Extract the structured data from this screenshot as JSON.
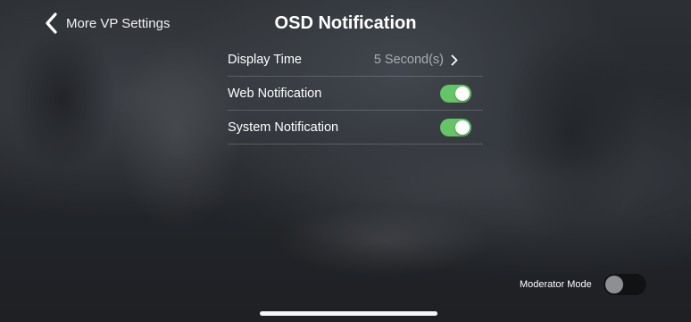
{
  "header": {
    "back_label": "More VP Settings",
    "title": "OSD Notification"
  },
  "settings": {
    "display_time": {
      "label": "Display Time",
      "value": "5 Second(s)"
    },
    "web_notification": {
      "label": "Web Notification",
      "enabled": true
    },
    "system_notification": {
      "label": "System Notification",
      "enabled": true
    }
  },
  "moderator": {
    "label": "Moderator Mode",
    "enabled": false
  },
  "colors": {
    "toggle_on": "#65c466",
    "toggle_off": "#111214",
    "text": "#ffffff"
  },
  "icons": {
    "back": "chevron-left-icon",
    "disclosure": "chevron-right-icon"
  }
}
